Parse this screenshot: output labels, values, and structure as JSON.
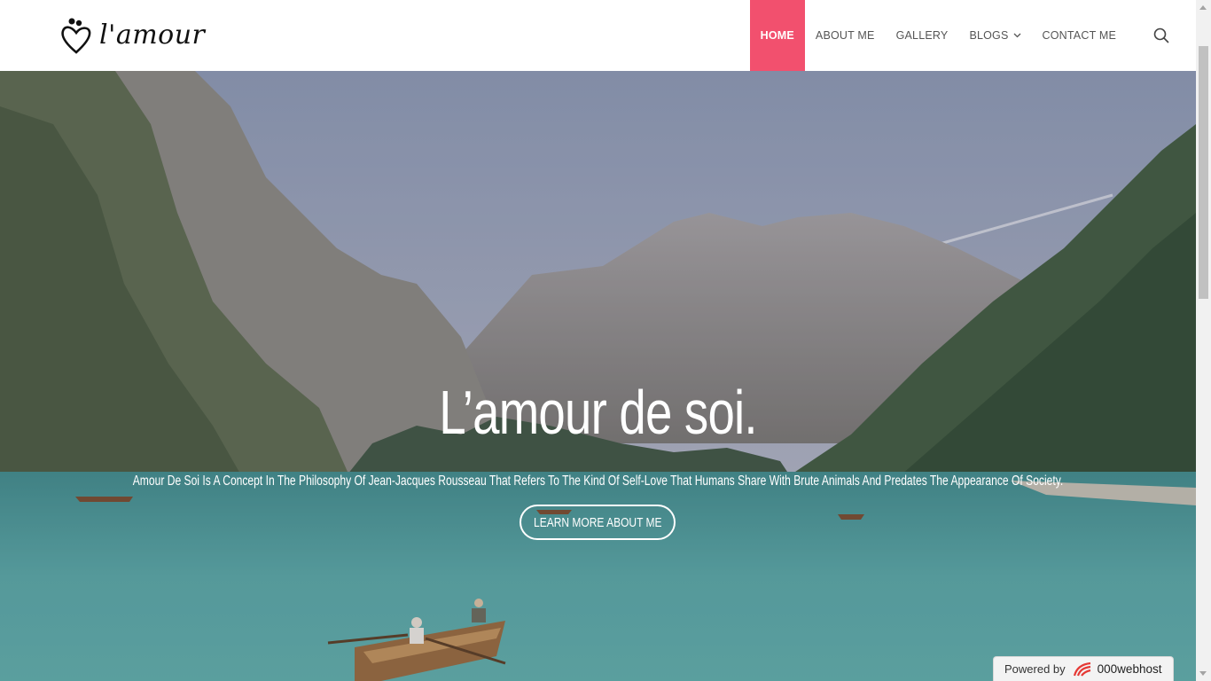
{
  "header": {
    "logo_text": "l'amour",
    "nav": [
      {
        "label": "HOME",
        "active": true
      },
      {
        "label": "ABOUT ME",
        "active": false
      },
      {
        "label": "GALLERY",
        "active": false
      },
      {
        "label": "BLOGS",
        "active": false,
        "has_dropdown": true
      },
      {
        "label": "CONTACT ME",
        "active": false
      }
    ],
    "search_icon": "search-icon"
  },
  "hero": {
    "title": "L’amour de soi.",
    "subtitle": "Amour De Soi Is A Concept In The Philosophy Of Jean-Jacques Rousseau That Refers To The Kind Of Self-Love That Humans Share With Brute Animals And Predates The Appearance Of Society.",
    "button_label": "LEARN MORE ABOUT ME"
  },
  "badge": {
    "powered_label": "Powered by",
    "brand": "000webhost"
  },
  "colors": {
    "accent": "#f2506e",
    "nav_text": "#555555"
  }
}
